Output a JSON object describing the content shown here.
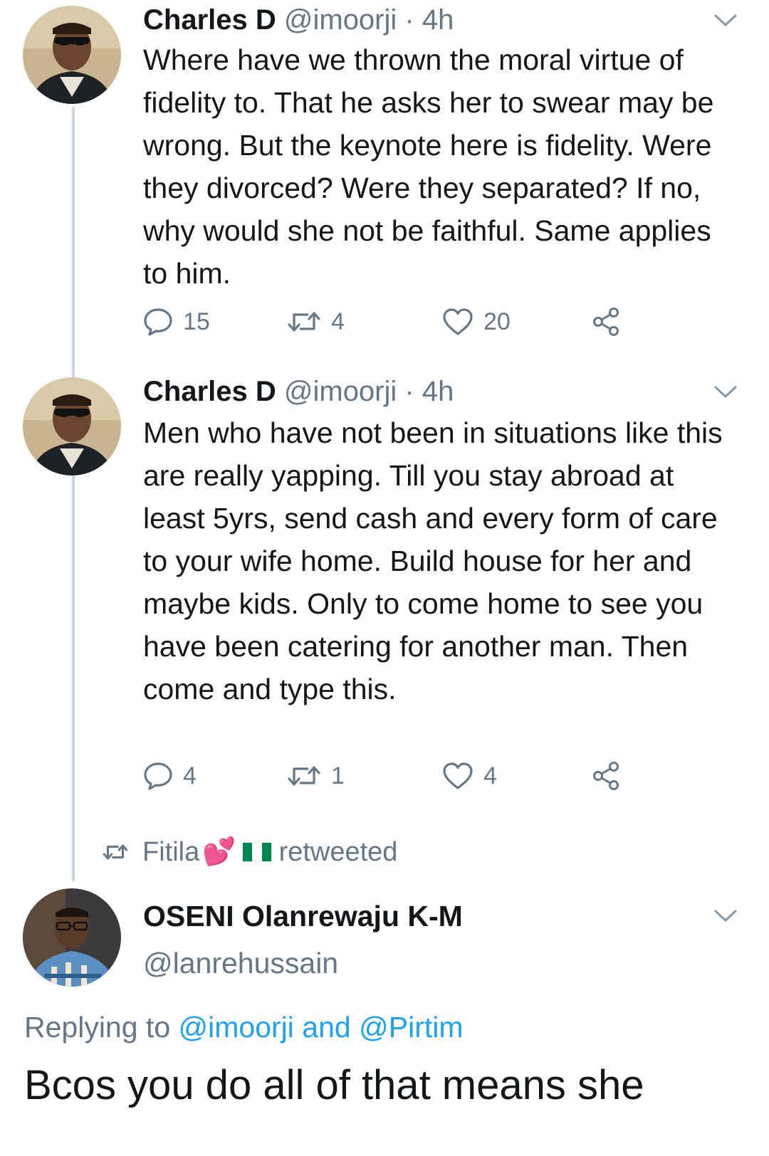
{
  "tweets": [
    {
      "name": "Charles D",
      "handle": "@imoorji",
      "separator": "·",
      "time": "4h",
      "text": "Where have we thrown the moral virtue of fidelity to. That he asks her to swear may be wrong. But the keynote here is fidelity. Were they divorced? Were they separated? If no, why would she not be faithful. Same applies to him.",
      "replies": "15",
      "retweets": "4",
      "likes": "20"
    },
    {
      "name": "Charles D",
      "handle": "@imoorji",
      "separator": "·",
      "time": "4h",
      "text": "Men who have not been in situations like this are really yapping. Till you stay abroad at least 5yrs, send cash and every form of care to your wife home. Build house for her and maybe kids. Only to come home to see you have been catering for another man. Then come and type this.",
      "replies": "4",
      "retweets": "1",
      "likes": "4"
    }
  ],
  "retweet_banner": {
    "user": "Fitila",
    "emoji": "💕",
    "label": "retweeted"
  },
  "focused_tweet": {
    "name": "OSENI Olanrewaju K-M",
    "handle": "@lanrehussain",
    "replying_prefix": "Replying to",
    "mention1": "@imoorji",
    "conjunction": "and",
    "mention2": "@Pirtim",
    "text": "Bcos you do all of that means she"
  },
  "colors": {
    "text": "#14171a",
    "secondary": "#657786",
    "link": "#1da1f2",
    "thread_line": "#ccd6dd"
  }
}
